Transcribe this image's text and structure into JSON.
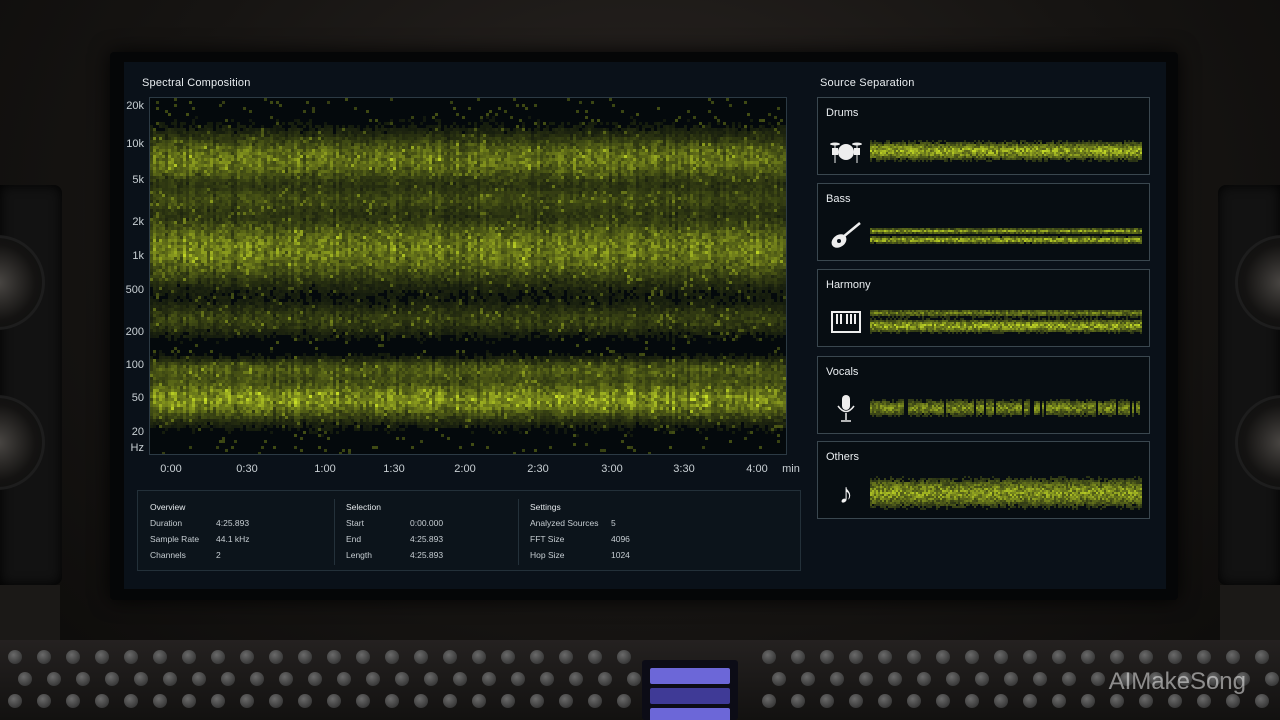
{
  "spectral": {
    "title": "Spectral Composition",
    "y_labels": [
      "20k",
      "10k",
      "5k",
      "2k",
      "1k",
      "500",
      "200",
      "100",
      "50",
      "20",
      "Hz"
    ],
    "x_labels": [
      "0:00",
      "0:30",
      "1:00",
      "1:30",
      "2:00",
      "2:30",
      "3:00",
      "3:30",
      "4:00",
      "min"
    ],
    "accent_color": "#c8e02a"
  },
  "info": {
    "overview": {
      "title": "Overview",
      "rows": [
        {
          "label": "Duration",
          "value": "4:25.893"
        },
        {
          "label": "Sample Rate",
          "value": "44.1 kHz"
        },
        {
          "label": "Channels",
          "value": "2"
        }
      ]
    },
    "selection": {
      "title": "Selection",
      "rows": [
        {
          "label": "Start",
          "value": "0:00.000"
        },
        {
          "label": "End",
          "value": "4:25.893"
        },
        {
          "label": "Length",
          "value": "4:25.893"
        }
      ]
    },
    "settings": {
      "title": "Settings",
      "rows": [
        {
          "label": "Analyzed Sources",
          "value": "5"
        },
        {
          "label": "FFT Size",
          "value": "4096"
        },
        {
          "label": "Hop Size",
          "value": "1024"
        }
      ]
    }
  },
  "separation": {
    "title": "Source Separation",
    "sources": [
      {
        "name": "Drums",
        "icon": "drum-kit-icon"
      },
      {
        "name": "Bass",
        "icon": "guitar-icon"
      },
      {
        "name": "Harmony",
        "icon": "piano-icon"
      },
      {
        "name": "Vocals",
        "icon": "microphone-icon"
      },
      {
        "name": "Others",
        "icon": "music-note-icon"
      }
    ]
  },
  "watermark": "AIMakeSong"
}
